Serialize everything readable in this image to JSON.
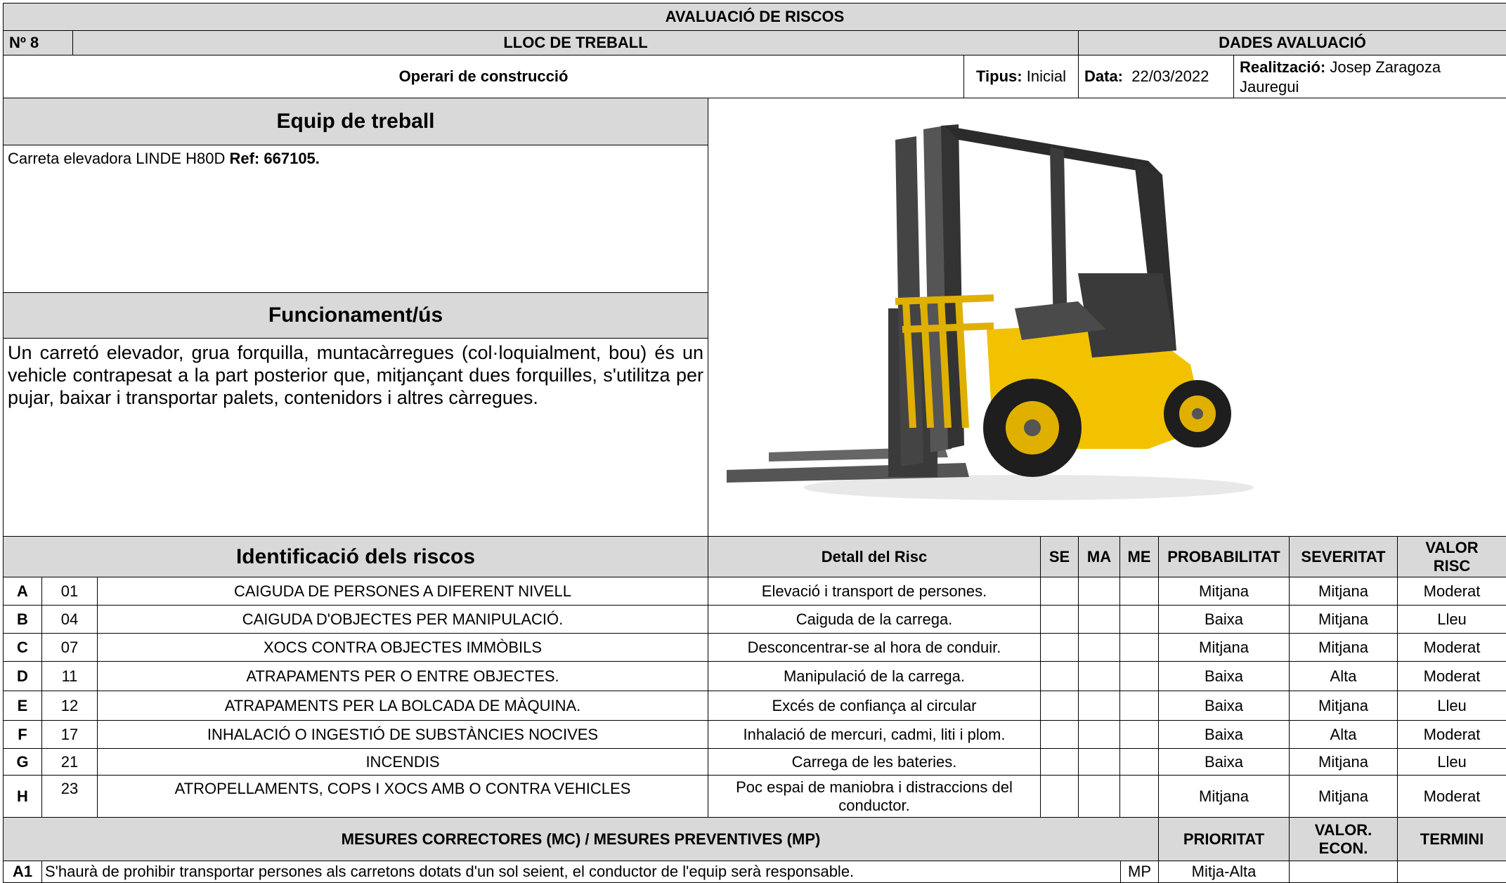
{
  "header": {
    "title": "AVALUACIÓ DE RISCOS",
    "number": "Nº 8",
    "workplace_heading": "LLOC DE TREBALL",
    "evaluation_heading": "DADES AVALUACIÓ",
    "workplace": "Operari de construcció",
    "type_label": "Tipus:",
    "type_value": "Inicial",
    "date_label": "Data:",
    "date_value": "22/03/2022",
    "author_label": "Realització:",
    "author_value_line1": "Josep Zaragoza",
    "author_value_line2": "Jauregui"
  },
  "equipment": {
    "heading": "Equip de treball",
    "name": "Carreta elevadora LINDE H80D ",
    "ref": "Ref: 667105."
  },
  "operation": {
    "heading": "Funcionament/ús",
    "text": "Un carretó elevador, grua forquilla, muntacàrregues (col·loquialment, bou) és un vehicle contrapesat a la part posterior que, mitjançant dues forquilles, s'utilitza per pujar, baixar i transportar palets, contenidors i altres càrregues."
  },
  "risks_table": {
    "headers": {
      "identification": "Identificació dels riscos",
      "detail": "Detall del Risc",
      "se": "SE",
      "ma": "MA",
      "me": "ME",
      "probability": "PROBABILITAT",
      "severity": "SEVERITAT",
      "value_line1": "VALOR",
      "value_line2": "RISC"
    },
    "rows": [
      {
        "letter": "A",
        "code": "01",
        "risk": "CAIGUDA DE PERSONES A DIFERENT NIVELL",
        "detail": "Elevació i transport de persones.",
        "detail2": "",
        "probability": "Mitjana",
        "severity": "Mitjana",
        "value": "Moderat"
      },
      {
        "letter": "B",
        "code": "04",
        "risk": "CAIGUDA D'OBJECTES PER MANIPULACIÓ.",
        "detail": "Caiguda de la carrega.",
        "detail2": "",
        "probability": "Baixa",
        "severity": "Mitjana",
        "value": "Lleu"
      },
      {
        "letter": "C",
        "code": "07",
        "risk": "XOCS CONTRA OBJECTES IMMÒBILS",
        "detail": "Desconcentrar-se al hora de conduir.",
        "detail2": "",
        "probability": "Mitjana",
        "severity": "Mitjana",
        "value": "Moderat"
      },
      {
        "letter": "D",
        "code": "11",
        "risk": "ATRAPAMENTS PER O ENTRE OBJECTES.",
        "detail": "Manipulació de la carrega.",
        "detail2": "",
        "probability": "Baixa",
        "severity": "Alta",
        "value": "Moderat"
      },
      {
        "letter": "E",
        "code": "12",
        "risk": "ATRAPAMENTS PER LA BOLCADA DE MÀQUINA.",
        "detail": "Excés de confiança al circular",
        "detail2": "",
        "probability": "Baixa",
        "severity": "Mitjana",
        "value": "Lleu"
      },
      {
        "letter": "F",
        "code": "17",
        "risk": "INHALACIÓ O INGESTIÓ DE SUBSTÀNCIES NOCIVES",
        "detail": "Inhalació de mercuri, cadmi, liti i plom.",
        "detail2": "",
        "probability": "Baixa",
        "severity": "Alta",
        "value": "Moderat"
      },
      {
        "letter": "G",
        "code": "21",
        "risk": "INCENDIS",
        "detail": "Carrega de les bateries.",
        "detail2": "",
        "probability": "Baixa",
        "severity": "Mitjana",
        "value": "Lleu"
      },
      {
        "letter": "H",
        "code": "23",
        "risk": "ATROPELLAMENTS, COPS I XOCS AMB O CONTRA VEHICLES",
        "detail": "Poc espai de maniobra i distraccions del",
        "detail2": "conductor.",
        "probability": "Mitjana",
        "severity": "Mitjana",
        "value": "Moderat"
      }
    ]
  },
  "measures_table": {
    "headers": {
      "title": "MESURES CORRECTORES (MC) / MESURES PREVENTIVES (MP)",
      "priority": "PRIORITAT",
      "econ_line1": "VALOR.",
      "econ_line2": "ECON.",
      "term": "TERMINI"
    },
    "rows": [
      {
        "code": "A1",
        "text": "S'haurà de prohibir transportar persones als carretons dotats d'un sol seient, el conductor de l'equip serà responsable.",
        "type": "MP",
        "priority": "Mitja-Alta",
        "econ": "",
        "term": ""
      }
    ]
  },
  "icons": {
    "equipment_photo": "forklift-photo",
    "colors": {
      "header_gray": "#d9d9d9",
      "forklift_yellow": "#f2c200"
    }
  }
}
